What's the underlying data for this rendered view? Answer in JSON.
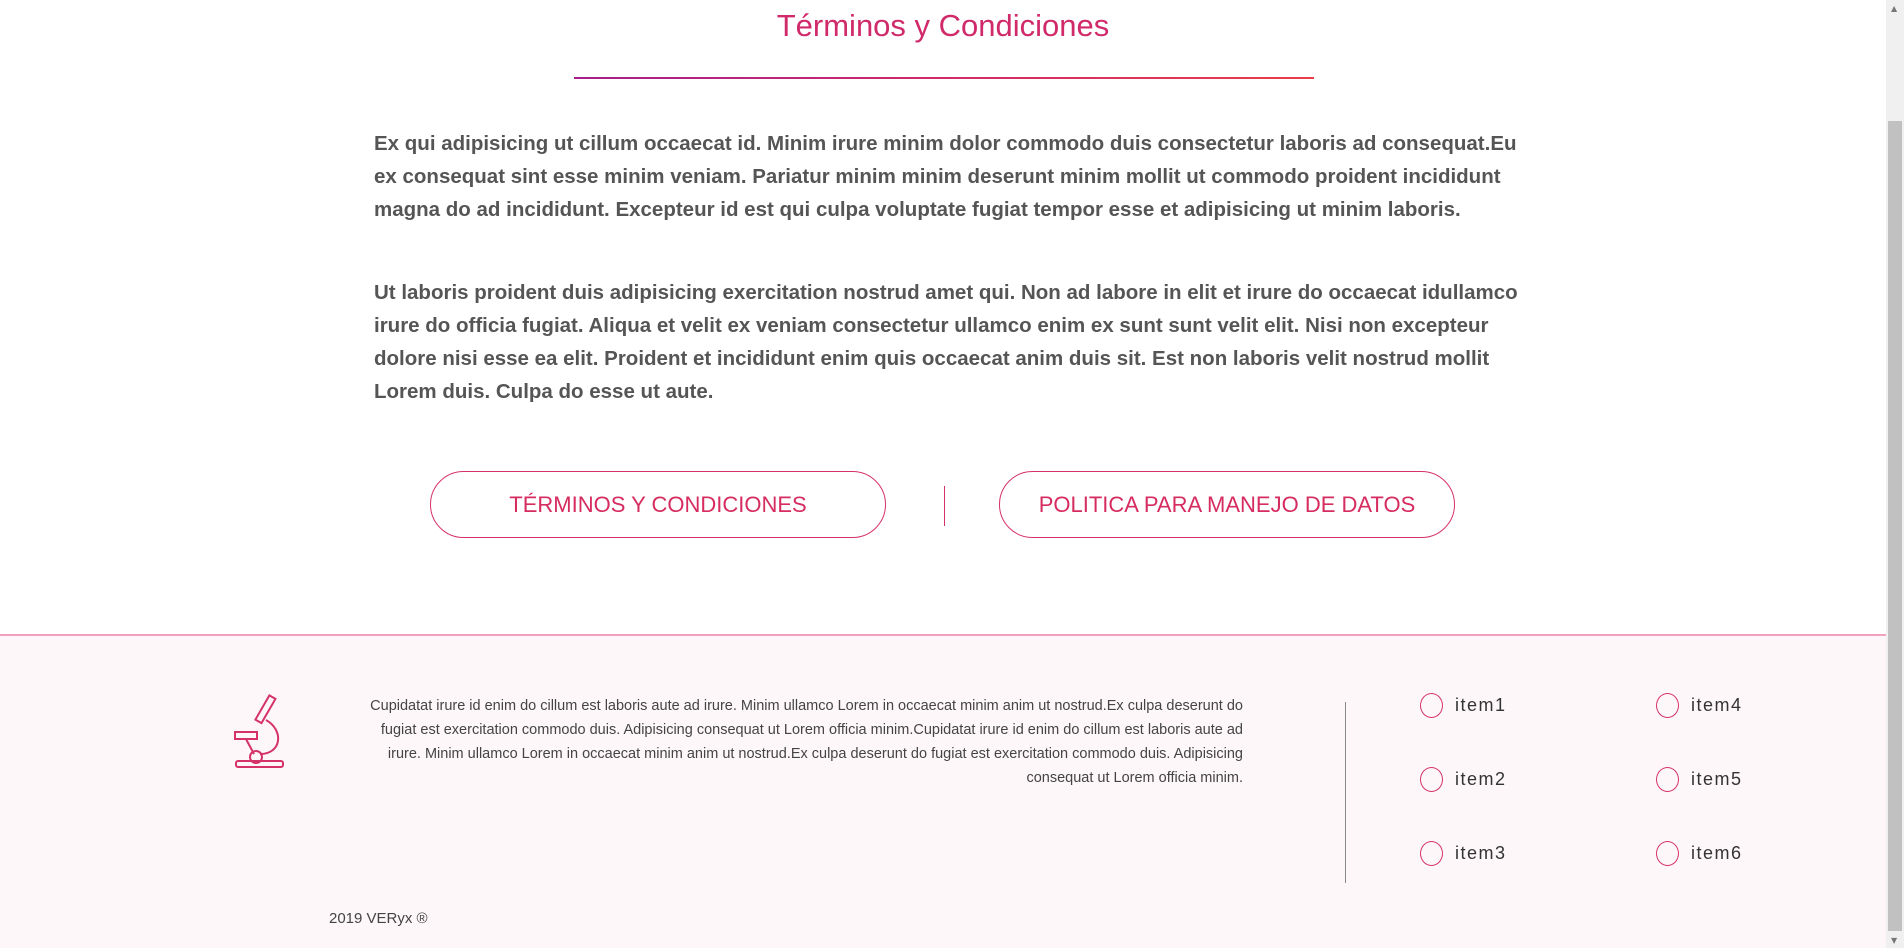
{
  "title": "Términos y Condiciones",
  "paragraphs": [
    "Ex qui adipisicing ut cillum occaecat id. Minim irure minim dolor commodo duis consectetur laboris ad consequat.Eu ex consequat sint esse minim veniam. Pariatur minim minim deserunt minim mollit ut commodo proident incididunt magna do ad incididunt. Excepteur id est qui culpa voluptate fugiat tempor esse et adipisicing ut minim laboris.",
    "Ut laboris proident duis adipisicing exercitation nostrud amet qui. Non ad labore in elit et irure do occaecat idullamco irure do officia fugiat. Aliqua et velit ex veniam consectetur ullamco enim ex sunt sunt velit elit. Nisi non excepteur dolore nisi esse ea elit. Proident et incididunt enim quis occaecat anim duis sit. Est non laboris velit nostrud mollit Lorem duis. Culpa do esse ut aute."
  ],
  "buttons": {
    "terms": "TÉRMINOS Y CONDICIONES",
    "privacy": "POLITICA PARA MANEJO DE DATOS"
  },
  "footer": {
    "icon": "microscope-icon",
    "text": "Cupidatat irure id enim do cillum est laboris aute ad irure. Minim ullamco Lorem in occaecat minim anim ut nostrud.Ex culpa deserunt do fugiat est exercitation commodo duis. Adipisicing consequat ut Lorem officia minim.Cupidatat irure id enim do cillum est laboris aute ad irure. Minim ullamco Lorem in occaecat minim anim ut nostrud.Ex culpa deserunt do fugiat est exercitation commodo duis. Adipisicing consequat ut Lorem officia minim.",
    "items": [
      "item1",
      "item2",
      "item3",
      "item4",
      "item5",
      "item6"
    ],
    "copyright": "2019 VERyx ®"
  },
  "colors": {
    "accent": "#d6326a",
    "footer_bg": "#fdf7f9"
  }
}
